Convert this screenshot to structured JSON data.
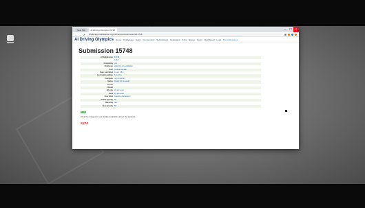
{
  "browser": {
    "tabs": [
      {
        "label": "New Tab"
      },
      {
        "label": "AI Driving Olympics 15748"
      }
    ],
    "window_controls": {
      "minimize": "–",
      "maximize": "□",
      "close": "×"
    },
    "nav": {
      "back": "←",
      "forward": "→",
      "reload": "⟳"
    },
    "url": "challenges.duckietown.org/v4/humans/submissions/15748",
    "extension_icons": [
      "ext-icon",
      "ext-icon",
      "ext-icon",
      "ext-icon"
    ]
  },
  "site": {
    "title": "AI Driving Olympics",
    "nav_items": [
      {
        "icon": "home-icon",
        "label": "Home"
      },
      {
        "icon": "trophy-icon",
        "label": "Challenges"
      },
      {
        "icon": "stopwatch-icon",
        "label": "Evals"
      },
      {
        "icon": "puzzle-icon",
        "label": "Components"
      },
      {
        "icon": "upload-icon",
        "label": "Submissions"
      },
      {
        "icon": "rocket-icon",
        "label": "Evaluators"
      },
      {
        "icon": "gear-icon",
        "label": "Jobs"
      },
      {
        "icon": "queue-icon",
        "label": "Queue"
      },
      {
        "icon": "users-icon",
        "label": "Users"
      },
      {
        "icon": "dashboard-icon",
        "label": "Dashboard"
      },
      {
        "icon": "lock-icon",
        "label": "Logs"
      }
    ],
    "right_link": "My submissions"
  },
  "page": {
    "title": "Submission 15748",
    "rows": [
      {
        "key": "AI Submission",
        "value": "15748"
      },
      {
        "key": "",
        "value": "Label"
      },
      {
        "key": "Competing",
        "value": "yes"
      },
      {
        "key": "Challenge",
        "value": "aido5-LF-sim-validation"
      },
      {
        "key": "User",
        "value": "Andrea Daniele"
      },
      {
        "key": "Date submitted",
        "value": "11 am, 48 s"
      },
      {
        "key": "Last status update",
        "value": "5 m, 49 s"
      },
      {
        "key": "Complete",
        "value": "not complete"
      },
      {
        "key": "Status",
        "value": "Ready (to be used)"
      },
      {
        "key": "Errors",
        "value": ""
      },
      {
        "key": "Result",
        "value": ""
      },
      {
        "key": "All jobs",
        "value": "LF-sim-eval"
      },
      {
        "key": "Next",
        "value": "LF-sim-eval"
      },
      {
        "key": "User label",
        "value": "baseline-duckietown"
      },
      {
        "key": "Admin priority",
        "value": "50"
      },
      {
        "key": "Blessing",
        "value": "n/a"
      },
      {
        "key": "User priority",
        "value": "50"
      }
    ],
    "badge": "1 jobs",
    "hint": "Click the images to see detailed statistics about the episode.",
    "sync": "sync"
  },
  "colors": {
    "accent": "#1a3a6b",
    "link": "#1a5bb5",
    "row_bg": "#eef4e8",
    "close": "#e81123",
    "sync": "#c9302c"
  }
}
